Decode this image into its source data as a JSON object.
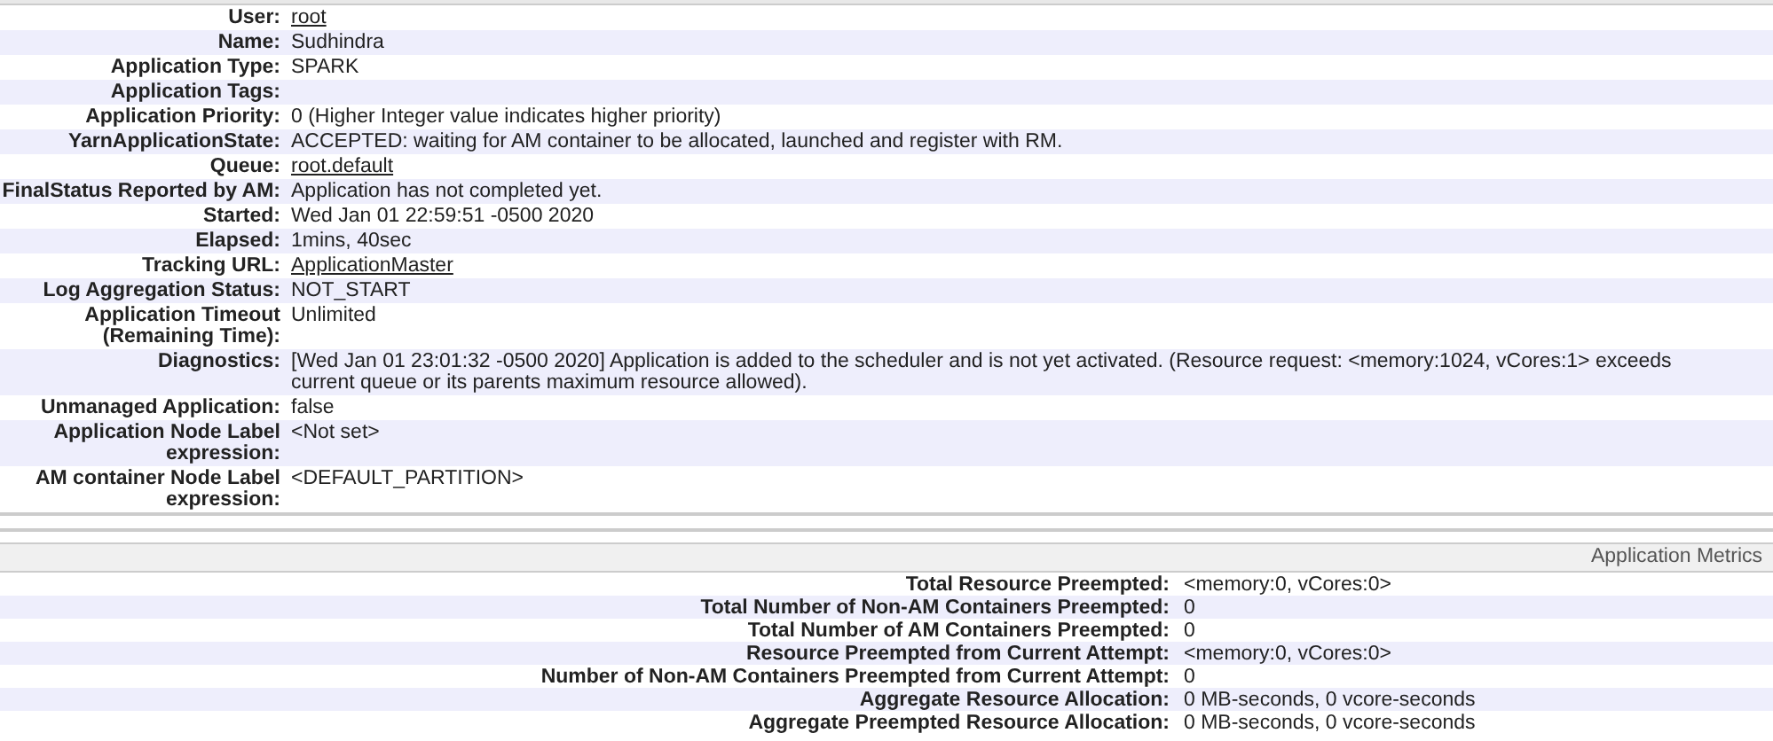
{
  "overview": {
    "rows": [
      {
        "label": "User:",
        "value": "root",
        "link": true
      },
      {
        "label": "Name:",
        "value": "Sudhindra",
        "link": false
      },
      {
        "label": "Application Type:",
        "value": "SPARK",
        "link": false
      },
      {
        "label": "Application Tags:"
      },
      {
        "label": "Application Priority:",
        "value": "0 (Higher Integer value indicates higher priority)",
        "link": false
      },
      {
        "label": "YarnApplicationState:",
        "value": "ACCEPTED: waiting for AM container to be allocated, launched and register with RM.",
        "link": false
      },
      {
        "label": "Queue:",
        "value": "root.default",
        "link": true
      },
      {
        "label": "FinalStatus Reported by AM:",
        "value": "Application has not completed yet.",
        "link": false
      },
      {
        "label": "Started:",
        "value": "Wed Jan 01 22:59:51 -0500 2020",
        "link": false
      },
      {
        "label": "Elapsed:",
        "value": "1mins, 40sec",
        "link": false
      },
      {
        "label": "Tracking URL:",
        "value": "ApplicationMaster",
        "link": true
      },
      {
        "label": "Log Aggregation Status:",
        "value": "NOT_START",
        "link": false
      },
      {
        "label": "Application Timeout (Remaining Time):",
        "value": "Unlimited",
        "link": false
      },
      {
        "label": "Diagnostics:",
        "value": "[Wed Jan 01 23:01:32 -0500 2020] Application is added to the scheduler and is not yet activated. (Resource request: <memory:1024, vCores:1> exceeds current queue or its parents maximum resource allowed).",
        "link": false
      },
      {
        "label": "Unmanaged Application:",
        "value": "false",
        "link": false
      },
      {
        "label": "Application Node Label expression:",
        "value": "<Not set>",
        "link": false
      },
      {
        "label": "AM container Node Label expression:",
        "value": "<DEFAULT_PARTITION>",
        "link": false
      }
    ]
  },
  "metrics": {
    "title": "Application Metrics",
    "rows": [
      {
        "label": "Total Resource Preempted:",
        "value": "<memory:0, vCores:0>"
      },
      {
        "label": "Total Number of Non-AM Containers Preempted:",
        "value": "0"
      },
      {
        "label": "Total Number of AM Containers Preempted:",
        "value": "0"
      },
      {
        "label": "Resource Preempted from Current Attempt:",
        "value": "<memory:0, vCores:0>"
      },
      {
        "label": "Number of Non-AM Containers Preempted from Current Attempt:",
        "value": "0"
      },
      {
        "label": "Aggregate Resource Allocation:",
        "value": "0 MB-seconds, 0 vcore-seconds"
      },
      {
        "label": "Aggregate Preempted Resource Allocation:",
        "value": "0 MB-seconds, 0 vcore-seconds"
      }
    ]
  }
}
